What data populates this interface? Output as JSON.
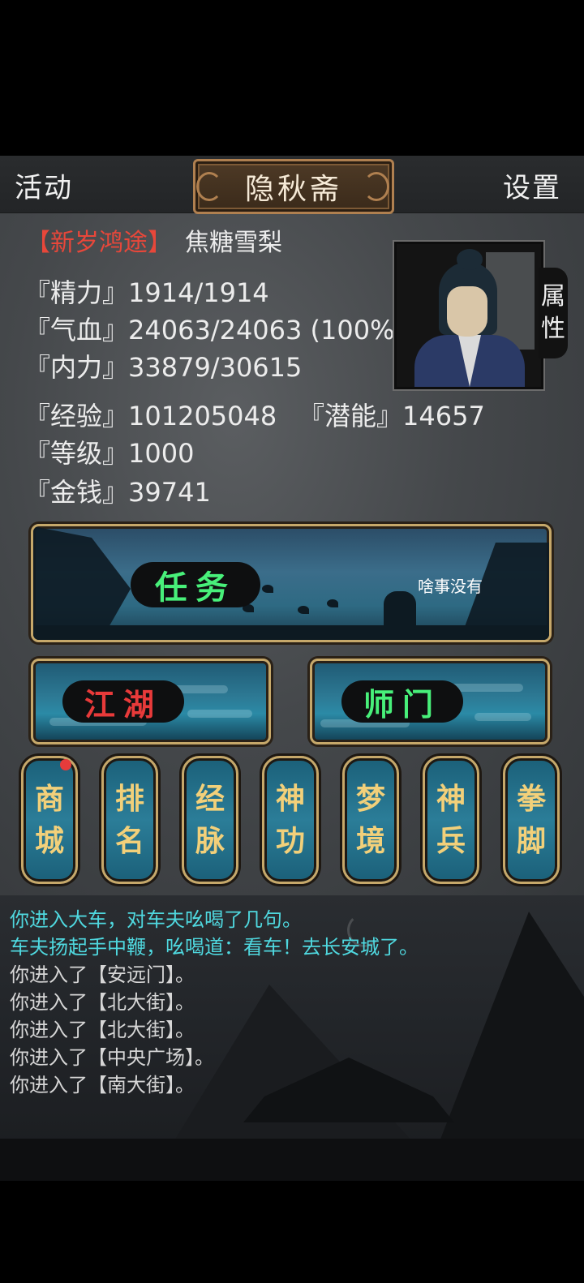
{
  "header": {
    "left_label": "活动",
    "title": "隐秋斋",
    "right_label": "设置"
  },
  "player": {
    "badge": "【新岁鸿途】",
    "name": "焦糖雪梨",
    "stats": {
      "stamina": "『精力』1914/1914",
      "health": "『气血』24063/24063 (100%)",
      "inner_power": "『内力』33879/30615",
      "experience": "『经验』101205048",
      "potential": "『潜能』14657",
      "level": "『等级』1000",
      "money": "『金钱』39741"
    },
    "attribute_tab": [
      "属",
      "性"
    ]
  },
  "mission": {
    "label": "任务",
    "note": "啥事没有"
  },
  "main_buttons": {
    "jianghu": "江湖",
    "shimen": "师门"
  },
  "menu_buttons": [
    {
      "line1": "商",
      "line2": "城",
      "has_alert": true
    },
    {
      "line1": "排",
      "line2": "名",
      "has_alert": false
    },
    {
      "line1": "经",
      "line2": "脉",
      "has_alert": false
    },
    {
      "line1": "神",
      "line2": "功",
      "has_alert": false
    },
    {
      "line1": "梦",
      "line2": "境",
      "has_alert": false
    },
    {
      "line1": "神",
      "line2": "兵",
      "has_alert": false
    },
    {
      "line1": "拳",
      "line2": "脚",
      "has_alert": false
    }
  ],
  "log": [
    {
      "text": "你进入大车，对车夫吆喝了几句。",
      "color": "#4fd8df"
    },
    {
      "text": "车夫扬起手中鞭，吆喝道：看车！去长安城了。",
      "color": "#4fd8df"
    },
    {
      "text": "你进入了【安远门】。",
      "color": "#d6d6d6"
    },
    {
      "text": "你进入了【北大街】。",
      "color": "#d6d6d6"
    },
    {
      "text": "你进入了【北大街】。",
      "color": "#d6d6d6"
    },
    {
      "text": "你进入了【中央广场】。",
      "color": "#d6d6d6"
    },
    {
      "text": "你进入了【南大街】。",
      "color": "#d6d6d6"
    }
  ],
  "colors": {
    "badge_red": "#e8473a",
    "mission_green": "#48f07a",
    "jianghu_red": "#e83a3a",
    "shimen_green": "#48f07a",
    "menu_gold": "#f2d07a"
  }
}
